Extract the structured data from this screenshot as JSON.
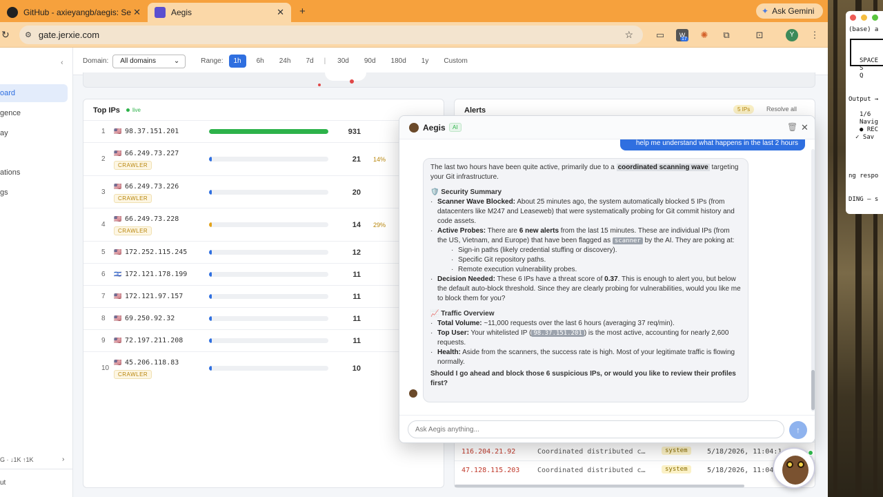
{
  "browser": {
    "tabs": [
      {
        "title": "GitHub - axieyangb/aegis: Se"
      },
      {
        "title": "Aegis"
      }
    ],
    "ask_gemini": "Ask Gemini",
    "url": "gate.jerxie.com",
    "extension_badge": "17",
    "profile_initial": "Y"
  },
  "terminal": {
    "lines": [
      "(base) a",
      "SPACE",
      "S",
      "Q",
      "Output →",
      "1/6",
      "Navig",
      "● REC",
      "✓ Sav",
      "ng respo",
      "DING — s"
    ]
  },
  "sidebar": {
    "collapse": "‹",
    "items": [
      "oard",
      "gence",
      "ay",
      "ations",
      "gs"
    ],
    "footer_stats": "G · ↓1K ↑1K",
    "footer_arrow": "›",
    "logout": "ut"
  },
  "filters": {
    "domain_label": "Domain:",
    "domain_value": "All domains",
    "range_label": "Range:",
    "ranges": [
      "1h",
      "6h",
      "24h",
      "7d",
      "30d",
      "90d",
      "180d",
      "1y",
      "Custom"
    ],
    "active_range": "1h",
    "separator": "|"
  },
  "top_ips": {
    "title": "Top IPs",
    "live": "live",
    "rows": [
      {
        "rank": "1",
        "flag": "🇺🇸",
        "ip": "98.37.151.201",
        "count": "931",
        "tag": "",
        "pct": "",
        "fill": 1.0,
        "color": "#2db24a"
      },
      {
        "rank": "2",
        "flag": "🇺🇸",
        "ip": "66.249.73.227",
        "count": "21",
        "tag": "CRAWLER",
        "pct": "14%",
        "fill": 0.022,
        "color": "#2f6fe0"
      },
      {
        "rank": "3",
        "flag": "🇺🇸",
        "ip": "66.249.73.226",
        "count": "20",
        "tag": "CRAWLER",
        "pct": "",
        "fill": 0.021,
        "color": "#2f6fe0"
      },
      {
        "rank": "4",
        "flag": "🇺🇸",
        "ip": "66.249.73.228",
        "count": "14",
        "tag": "CRAWLER",
        "pct": "29%",
        "fill": 0.015,
        "color": "#e3a21a"
      },
      {
        "rank": "5",
        "flag": "🇺🇸",
        "ip": "172.252.115.245",
        "count": "12",
        "tag": "",
        "pct": "",
        "fill": 0.013,
        "color": "#2f6fe0"
      },
      {
        "rank": "6",
        "flag": "🇮🇱",
        "ip": "172.121.178.199",
        "count": "11",
        "tag": "",
        "pct": "",
        "fill": 0.012,
        "color": "#2f6fe0"
      },
      {
        "rank": "7",
        "flag": "🇺🇸",
        "ip": "172.121.97.157",
        "count": "11",
        "tag": "",
        "pct": "",
        "fill": 0.012,
        "color": "#2f6fe0"
      },
      {
        "rank": "8",
        "flag": "🇺🇸",
        "ip": "69.250.92.32",
        "count": "11",
        "tag": "",
        "pct": "",
        "fill": 0.012,
        "color": "#2f6fe0"
      },
      {
        "rank": "9",
        "flag": "🇺🇸",
        "ip": "72.197.211.208",
        "count": "11",
        "tag": "",
        "pct": "",
        "fill": 0.012,
        "color": "#2f6fe0"
      },
      {
        "rank": "10",
        "flag": "🇺🇸",
        "ip": "45.206.118.83",
        "count": "10",
        "tag": "CRAWLER",
        "pct": "",
        "fill": 0.011,
        "color": "#2f6fe0"
      }
    ]
  },
  "alerts": {
    "title": "Alerts",
    "count_badge": "5 IPs",
    "resolve_all": "Resolve all",
    "rows": [
      {
        "ip": "116.204.21.92",
        "desc": "Coordinated distributed c…",
        "source": "system",
        "date": "5/18/2026, 11:04:1"
      },
      {
        "ip": "47.128.115.203",
        "desc": "Coordinated distributed c…",
        "source": "system",
        "date": "5/18/2026, 11:04:1"
      }
    ]
  },
  "chat": {
    "title": "Aegis",
    "ai_badge": "AI",
    "user_message": "help me understand what happens in the last 2 hours",
    "intro_1": "The last two hours have been quite active, primarily due to a ",
    "intro_bold": "coordinated scanning wave",
    "intro_2": " targeting your Git infrastructure.",
    "security_heading": "🛡️ Security Summary",
    "scanner_label": "Scanner Wave Blocked:",
    "scanner_text": " About 25 minutes ago, the system automatically blocked 5 IPs (from datacenters like M247 and Leaseweb) that were systematically probing for Git commit history and code assets.",
    "probes_label": "Active Probes:",
    "probes_text_1": " There are ",
    "probes_bold": "6 new alerts",
    "probes_text_2": " from the last 15 minutes. These are individual IPs (from the US, Vietnam, and Europe) that have been flagged as ",
    "probes_code": "scanner",
    "probes_text_3": " by the AI. They are poking at:",
    "probe_items": [
      "Sign-in paths (likely credential stuffing or discovery).",
      "Specific Git repository paths.",
      "Remote execution vulnerability probes."
    ],
    "decision_label": "Decision Needed:",
    "decision_text_1": " These 6 IPs have a threat score of ",
    "decision_bold": "0.37",
    "decision_text_2": ". This is enough to alert you, but below the default auto-block threshold. Since they are clearly probing for vulnerabilities, would you like me to block them for you?",
    "traffic_heading": "📈 Traffic Overview",
    "volume_label": "Total Volume:",
    "volume_text": " ~11,000 requests over the last 6 hours (averaging 37 req/min).",
    "topuser_label": "Top User:",
    "topuser_text_1": " Your whitelisted IP (",
    "topuser_code": "98.37.151.201",
    "topuser_text_2": ") is the most active, accounting for nearly 2,600 requests.",
    "health_label": "Health:",
    "health_text": " Aside from the scanners, the success rate is high. Most of your legitimate traffic is flowing normally.",
    "closing": "Should I go ahead and block those 6 suspicious IPs, or would you like to review their profiles first?",
    "input_placeholder": "Ask Aegis anything...",
    "send_icon": "↑"
  }
}
